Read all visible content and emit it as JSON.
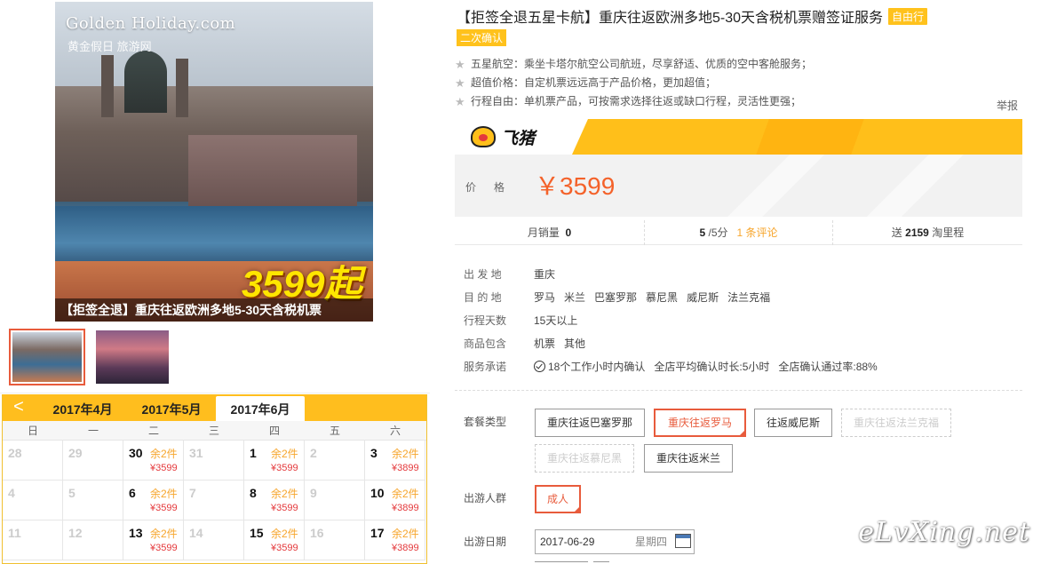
{
  "product": {
    "title": "【拒签全退五星卡航】重庆往返欧洲多地5-30天含税机票赠签证服务",
    "tag": "自由行",
    "tag2": "二次确认",
    "features": [
      "五星航空：乘坐卡塔尔航空公司航班，尽享舒适、优质的空中客舱服务；",
      "超值价格：自定机票远远高于产品价格，更加超值；",
      "行程自由：单机票产品，可按需求选择往返或缺口行程，灵活性更强；"
    ],
    "report": "举报"
  },
  "image": {
    "logo": "Golden Holiday.com",
    "logo_sub": "黄金假日 旅游网",
    "promo": "3599起",
    "banner": "【拒签全退】重庆往返欧洲多地5-30天含税机票"
  },
  "price": {
    "brand": "飞猪",
    "label": "价格",
    "value": "￥3599"
  },
  "stats": {
    "monthly_label": "月销量",
    "monthly_value": "0",
    "score": "5",
    "score_suffix": "/5分",
    "reviews": "1 条评论",
    "points_prefix": "送",
    "points": "2159",
    "points_suffix": "淘里程"
  },
  "info": {
    "depart_label": "出 发 地",
    "depart": "重庆",
    "dest_label": "目 的 地",
    "dests": [
      "罗马",
      "米兰",
      "巴塞罗那",
      "慕尼黑",
      "威尼斯",
      "法兰克福"
    ],
    "days_label": "行程天数",
    "days": "15天以上",
    "includes_label": "商品包含",
    "includes": [
      "机票",
      "其他"
    ],
    "service_label": "服务承诺",
    "service": [
      "18个工作小时内确认",
      "全店平均确认时长:5小时",
      "全店确认通过率:88%"
    ]
  },
  "options": {
    "package_label": "套餐类型",
    "packages": [
      {
        "label": "重庆往返巴塞罗那",
        "state": "normal"
      },
      {
        "label": "重庆往返罗马",
        "state": "selected"
      },
      {
        "label": "往返威尼斯",
        "state": "normal"
      },
      {
        "label": "重庆往返法兰克福",
        "state": "disabled"
      },
      {
        "label": "重庆往返慕尼黑",
        "state": "disabled"
      },
      {
        "label": "重庆往返米兰",
        "state": "normal"
      }
    ],
    "crowd_label": "出游人群",
    "crowd": "成人",
    "date_label": "出游日期",
    "date": "2017-06-29",
    "weekday": "星期四"
  },
  "calendar": {
    "prev": "<",
    "months": [
      "2017年4月",
      "2017年5月",
      "2017年6月"
    ],
    "weekdays": [
      "日",
      "一",
      "二",
      "三",
      "四",
      "五",
      "六"
    ],
    "rows": [
      [
        {
          "d": "28"
        },
        {
          "d": "29"
        },
        {
          "d": "30",
          "s": "余2件",
          "p": "¥3599"
        },
        {
          "d": "31"
        },
        {
          "d": "1",
          "s": "余2件",
          "p": "¥3599"
        },
        {
          "d": "2"
        },
        {
          "d": "3",
          "s": "余2件",
          "p": "¥3899"
        }
      ],
      [
        {
          "d": "4"
        },
        {
          "d": "5"
        },
        {
          "d": "6",
          "s": "余2件",
          "p": "¥3599"
        },
        {
          "d": "7"
        },
        {
          "d": "8",
          "s": "余2件",
          "p": "¥3599"
        },
        {
          "d": "9"
        },
        {
          "d": "10",
          "s": "余2件",
          "p": "¥3899"
        }
      ],
      [
        {
          "d": "11"
        },
        {
          "d": "12"
        },
        {
          "d": "13",
          "s": "余2件",
          "p": "¥3599"
        },
        {
          "d": "14"
        },
        {
          "d": "15",
          "s": "余2件",
          "p": "¥3599"
        },
        {
          "d": "16"
        },
        {
          "d": "17",
          "s": "余2件",
          "p": "¥3899"
        }
      ]
    ]
  },
  "watermark": "eLvXing.net",
  "colors": {
    "accent": "#ffbf1a",
    "price": "#f4622a",
    "selected": "#e85b3c",
    "stock": "#f7a52b",
    "cal_price": "#e4393c"
  }
}
